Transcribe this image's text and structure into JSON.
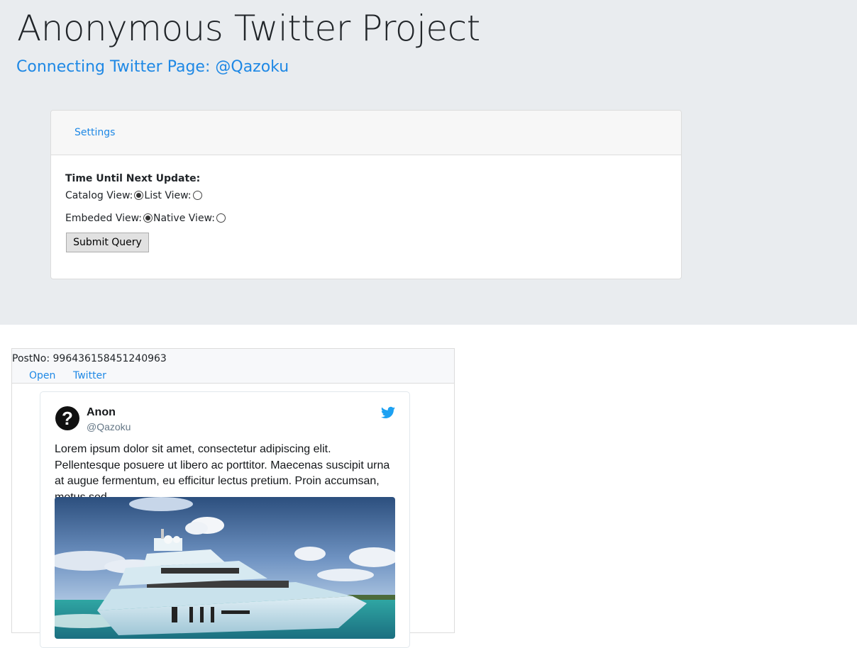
{
  "header": {
    "title": "Anonymous Twitter Project",
    "subtitle": "Connecting Twitter Page: @Qazoku"
  },
  "settings": {
    "tab_label": "Settings",
    "timer_label": "Time Until Next Update:",
    "catalog_label": "Catalog View:",
    "list_label": "List View:",
    "embedded_label": "Embeded View:",
    "native_label": "Native View:",
    "catalog_checked": true,
    "list_checked": false,
    "embedded_checked": true,
    "native_checked": false,
    "submit_label": "Submit Query"
  },
  "post": {
    "postno_label": "PostNo:",
    "postno_value": "996436158451240963",
    "open_label": "Open",
    "twitter_label": "Twitter"
  },
  "tweet": {
    "name": "Anon",
    "handle": "@Qazoku",
    "text": "Lorem ipsum dolor sit amet, consectetur adipiscing elit. Pellentesque posuere ut libero ac porttitor. Maecenas suscipit urna at augue fermentum, eu efficitur lectus pretium. Proin accumsan, metus sed.",
    "avatar_icon": "question-mark-icon",
    "brand_icon": "twitter-bird-icon",
    "media_description": "yacht-photo",
    "brand_color": "#1da1f2"
  },
  "colors": {
    "accent": "#1e88e5",
    "jumbotron_bg": "#e9ecef"
  }
}
